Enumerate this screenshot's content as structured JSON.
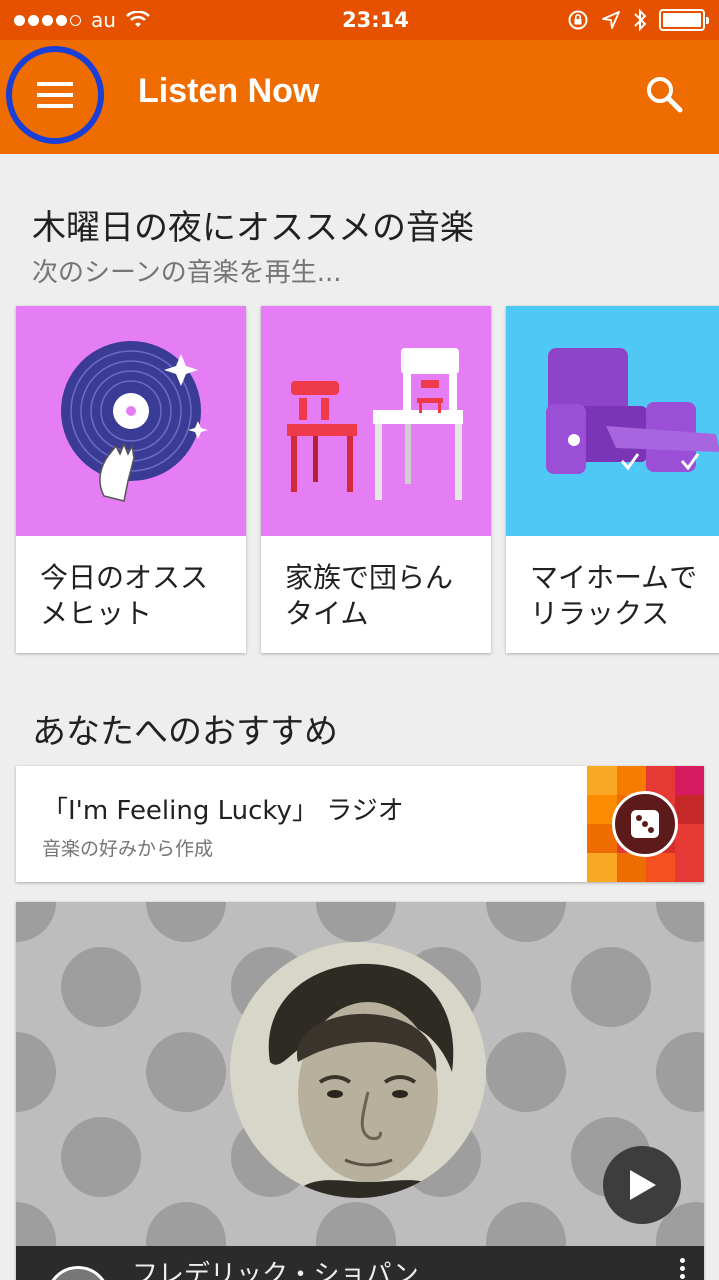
{
  "status_bar": {
    "carrier": "au",
    "time": "23:14"
  },
  "app_bar": {
    "title": "Listen Now",
    "menu_icon": "hamburger-menu-icon",
    "search_icon": "search-icon",
    "accent_color": "#ef6c00",
    "highlight_color": "#1a3fd6"
  },
  "section_recommend": {
    "title": "木曜日の夜にオススメの音楽",
    "subtitle": "次のシーンの音楽を再生...",
    "cards": [
      {
        "label_line1": "今日のオスス",
        "label_line2": "メヒット",
        "bg": "#e57ef4",
        "icon": "vinyl-record-icon"
      },
      {
        "label_line1": "家族で団らん",
        "label_line2": "タイム",
        "bg": "#e57ef4",
        "icon": "chairs-icon"
      },
      {
        "label_line1": "マイホームで",
        "label_line2": "リラックス",
        "bg": "#4fc8f6",
        "icon": "recliner-icon"
      }
    ]
  },
  "section_for_you": {
    "title": "あなたへのおすすめ",
    "lucky_radio": {
      "title": "「I'm Feeling Lucky」 ラジオ",
      "subtitle": "音楽の好みから作成",
      "icon": "dice-icon"
    },
    "artist_card": {
      "name": "フレデリック・ショパン",
      "play_icon": "play-icon",
      "more_icon": "more-vert-icon"
    }
  }
}
